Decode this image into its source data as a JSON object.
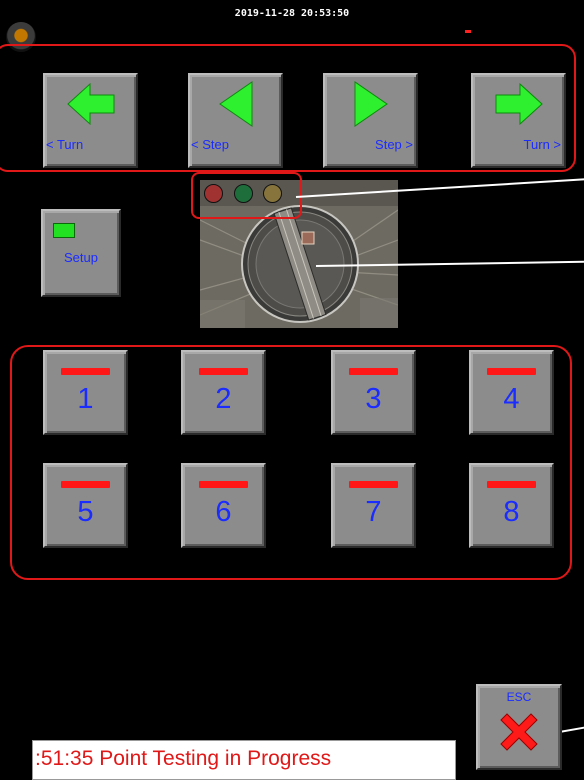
{
  "header": {
    "timestamp": "2019-11-28 20:53:50"
  },
  "nav": [
    {
      "label": "< Turn",
      "icon": "arrow-left-icon"
    },
    {
      "label": "< Step",
      "icon": "triangle-left-icon"
    },
    {
      "label": "Step >",
      "icon": "triangle-right-icon"
    },
    {
      "label": "Turn >",
      "icon": "arrow-right-icon"
    }
  ],
  "setup": {
    "label": "Setup",
    "led_color": "#22e022"
  },
  "camera": {
    "lamps": [
      "#a03232",
      "#1e6e3c",
      "#86743c"
    ]
  },
  "turntable_positions": [
    {
      "label": "1"
    },
    {
      "label": "2"
    },
    {
      "label": "3"
    },
    {
      "label": "4"
    },
    {
      "label": "5"
    },
    {
      "label": "6"
    },
    {
      "label": "7"
    },
    {
      "label": "8"
    }
  ],
  "esc": {
    "label": "ESC"
  },
  "status": {
    "message": ":51:35 Point Testing in Progress"
  },
  "colors": {
    "accent_outline": "#e01818",
    "label_blue": "#1b2cff",
    "button_gray": "#8c8c8c",
    "green_icon": "#2ef02e",
    "red_bar": "#ff1616"
  }
}
